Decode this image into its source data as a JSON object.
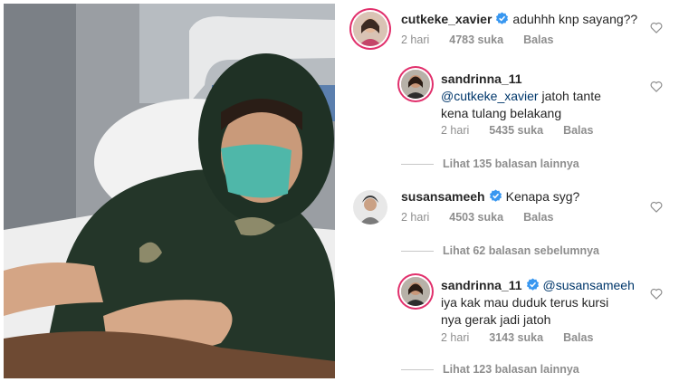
{
  "comments": [
    {
      "username": "cutkeke_xavier",
      "text": "aduhhh knp sayang??",
      "time": "2 hari",
      "likes": "4783 suka",
      "reply": "Balas",
      "verified": true,
      "avatar_icon": "avatar-woman-icon"
    },
    {
      "username": "sandrinna_11",
      "mention": "@cutkeke_xavier",
      "text_line1": " jatoh tante",
      "text_line2": "kena tulang belakang",
      "time": "2 hari",
      "likes": "5435 suka",
      "reply": "Balas",
      "verified": false,
      "avatar_icon": "avatar-girl-icon"
    },
    {
      "username": "susansameeh",
      "text": "Kenapa syg?",
      "time": "2 hari",
      "likes": "4503 suka",
      "reply": "Balas",
      "verified": true,
      "avatar_icon": "avatar-woman-icon"
    },
    {
      "username": "sandrinna_11",
      "mention": "@susansameeh",
      "text_line1": "iya kak mau duduk terus kursi",
      "text_line2": "nya gerak jadi jatoh",
      "time": "2 hari",
      "likes": "3143 suka",
      "reply": "Balas",
      "verified": true,
      "avatar_icon": "avatar-girl-icon"
    }
  ],
  "view_replies": [
    "Lihat 135 balasan lainnya",
    "Lihat 62 balasan sebelumnya",
    "Lihat 123 balasan lainnya"
  ],
  "colors": {
    "verified_blue": "#3897f0",
    "mention": "#00376b",
    "meta_gray": "#8e8e8e",
    "story_ring": "#e1306c"
  }
}
